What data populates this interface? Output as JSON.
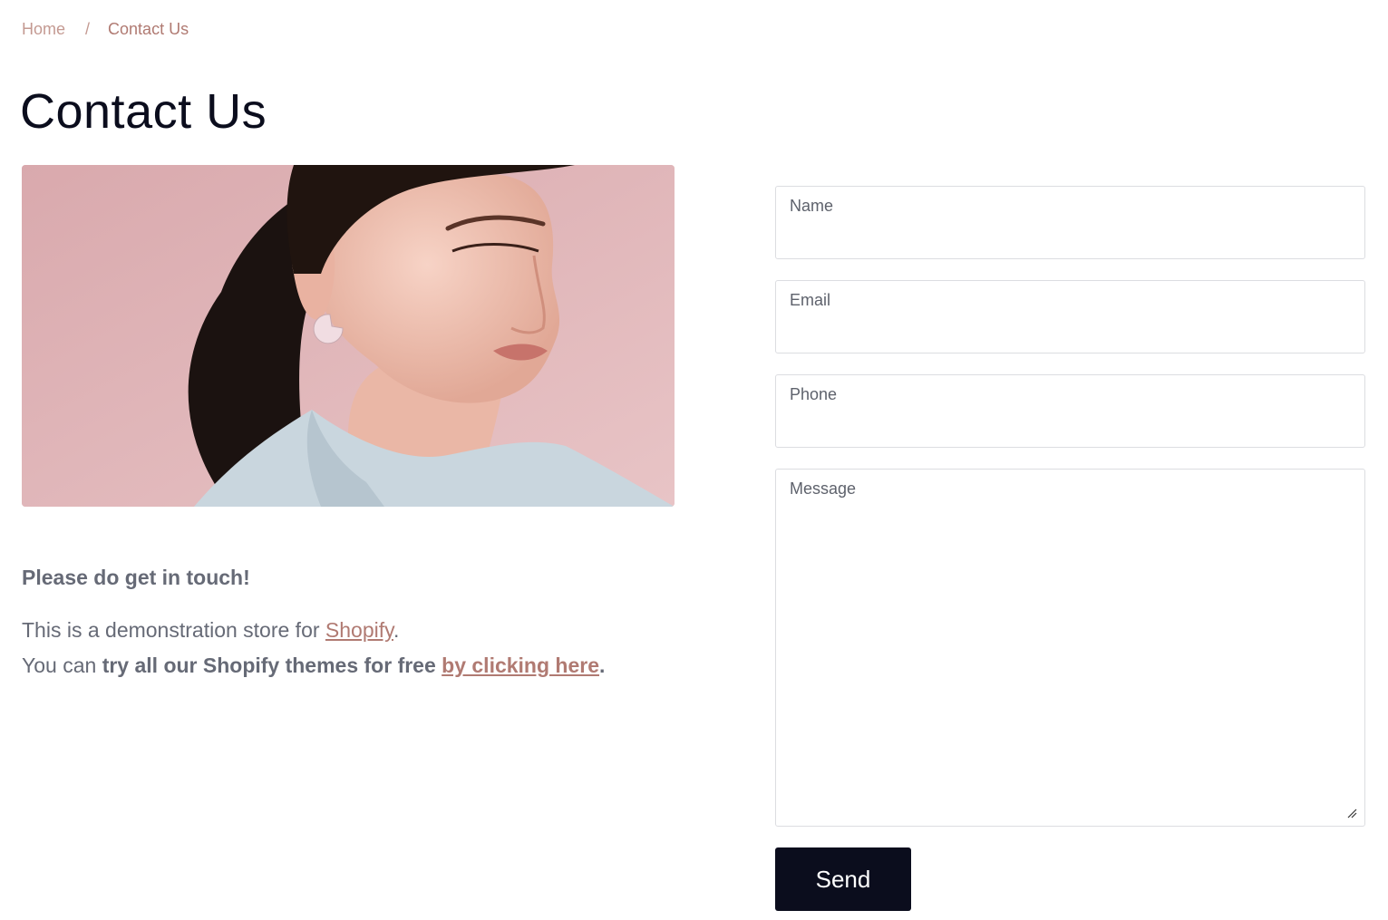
{
  "breadcrumb": {
    "home": "Home",
    "separator": "/",
    "current": "Contact Us"
  },
  "page": {
    "title": "Contact Us"
  },
  "hero_image": {
    "description": "portrait-photo"
  },
  "intro": {
    "heading": "Please do get in touch!",
    "line1_prefix": "This is a demonstration store for ",
    "line1_link": "Shopify",
    "line1_suffix": ".",
    "line2_prefix": "You can ",
    "line2_bold": "try all our Shopify themes for free ",
    "line2_link": "by clicking here",
    "line2_suffix": "."
  },
  "form": {
    "name_label": "Name",
    "name_value": "",
    "email_label": "Email",
    "email_value": "",
    "phone_label": "Phone",
    "phone_value": "",
    "message_label": "Message",
    "message_value": "",
    "send_label": "Send"
  },
  "colors": {
    "accent": "#b07a72",
    "dark": "#0b0d1d",
    "text_muted": "#666a76",
    "border": "#dcdde1"
  }
}
